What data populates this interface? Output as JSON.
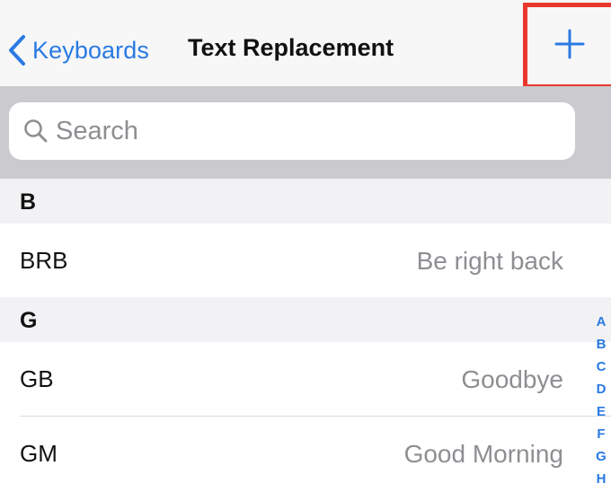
{
  "navbar": {
    "back_label": "Keyboards",
    "title": "Text Replacement",
    "add_symbol": "+"
  },
  "search": {
    "placeholder": "Search"
  },
  "sections": [
    {
      "letter": "B",
      "rows": [
        {
          "shortcut": "BRB",
          "phrase": "Be right back"
        }
      ]
    },
    {
      "letter": "G",
      "rows": [
        {
          "shortcut": "GB",
          "phrase": "Goodbye"
        },
        {
          "shortcut": "GM",
          "phrase": "Good Morning"
        }
      ]
    }
  ],
  "index": [
    "A",
    "B",
    "C",
    "D",
    "E",
    "F",
    "G",
    "H"
  ],
  "colors": {
    "accent": "#2a7ae2",
    "highlight": "#e8382c"
  },
  "icons": {
    "back": "chevron-left-icon",
    "search": "magnifier-icon",
    "add": "plus-icon"
  }
}
